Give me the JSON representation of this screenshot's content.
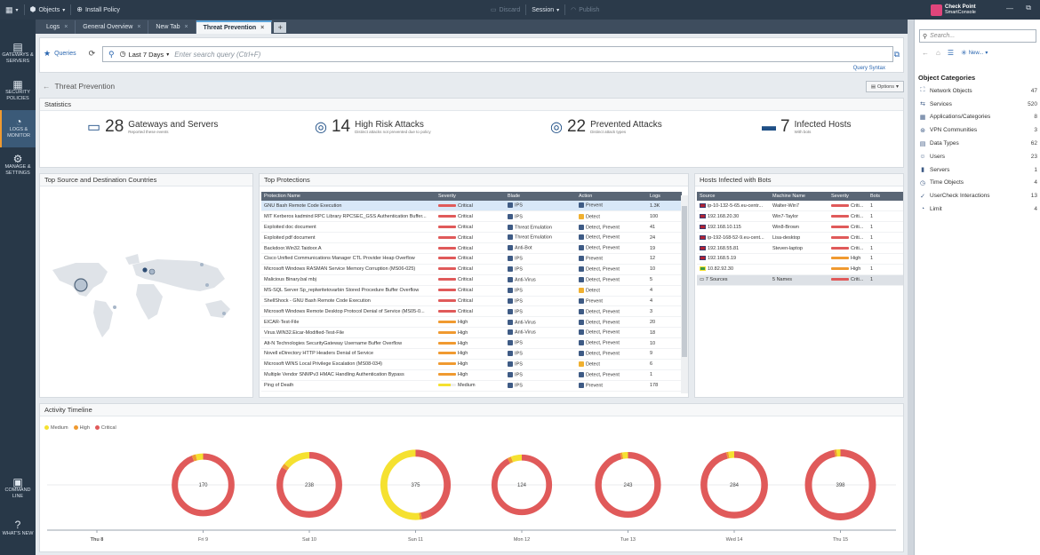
{
  "topbar": {
    "objects_label": "Objects",
    "install_policy_label": "Install Policy",
    "discard_label": "Discard",
    "session_label": "Session",
    "publish_label": "Publish"
  },
  "tabs": [
    {
      "label": "Logs"
    },
    {
      "label": "General Overview"
    },
    {
      "label": "New Tab"
    },
    {
      "label": "Threat Prevention"
    }
  ],
  "leftnav": [
    {
      "label": "GATEWAYS & SERVERS",
      "icon": "gateways-icon"
    },
    {
      "label": "SECURITY POLICIES",
      "icon": "policies-icon"
    },
    {
      "label": "LOGS & MONITOR",
      "icon": "gauge-icon",
      "active": true
    },
    {
      "label": "MANAGE & SETTINGS",
      "icon": "gear-icon"
    },
    {
      "label": "COMMAND LINE",
      "icon": "terminal-icon"
    },
    {
      "label": "WHAT'S NEW",
      "icon": "help-icon"
    }
  ],
  "query": {
    "queries_label": "Queries",
    "time_range": "Last 7 Days",
    "placeholder": "Enter search query (Ctrl+F)",
    "syntax_label": "Query Syntax"
  },
  "breadcrumb": "Threat Prevention",
  "options_label": "Options",
  "statistics": {
    "title": "Statistics",
    "items": [
      {
        "num": "28",
        "title": "Gateways and Servers",
        "sub": "Reported these events"
      },
      {
        "num": "14",
        "title": "High Risk Attacks",
        "sub": "Distinct attacks not prevented due to policy"
      },
      {
        "num": "22",
        "title": "Prevented Attacks",
        "sub": "Distinct attack types"
      },
      {
        "num": "7",
        "title": "Infected Hosts",
        "sub": "With bots"
      }
    ]
  },
  "countries_panel": {
    "title": "Top Source and Destination Countries"
  },
  "protections": {
    "title": "Top Protections",
    "columns": [
      "Protection Name",
      "Severity",
      "Blade",
      "Action",
      "Logs"
    ],
    "rows": [
      {
        "name": "GNU Bash Remote Code Execution",
        "severity": "Critical",
        "blade": "IPS",
        "action": "Prevent",
        "logs": "1.3K"
      },
      {
        "name": "MIT Kerberos kadmind RPC Library RPCSEC_GSS Authentication Buffer...",
        "severity": "Critical",
        "blade": "IPS",
        "action": "Detect",
        "logs": "100"
      },
      {
        "name": "Exploited doc document",
        "severity": "Critical",
        "blade": "Threat Emulation",
        "action": "Detect, Prevent",
        "logs": "41"
      },
      {
        "name": "Exploited pdf document",
        "severity": "Critical",
        "blade": "Threat Emulation",
        "action": "Detect, Prevent",
        "logs": "24"
      },
      {
        "name": "Backdoor.Win32.Taidoor.A",
        "severity": "Critical",
        "blade": "Anti-Bot",
        "action": "Detect, Prevent",
        "logs": "19"
      },
      {
        "name": "Cisco Unified Communications Manager CTL Provider Heap Overflow",
        "severity": "Critical",
        "blade": "IPS",
        "action": "Prevent",
        "logs": "12"
      },
      {
        "name": "Microsoft Windows RASMAN Service Memory Corruption (MS06-025)",
        "severity": "Critical",
        "blade": "IPS",
        "action": "Detect, Prevent",
        "logs": "10"
      },
      {
        "name": "Malicious Binary.bal mbj",
        "severity": "Critical",
        "blade": "Anti-Virus",
        "action": "Detect, Prevent",
        "logs": "5"
      },
      {
        "name": "MS-SQL Server Sp_replwritetovarbin Stored Procedure Buffer Overflow",
        "severity": "Critical",
        "blade": "IPS",
        "action": "Detect",
        "logs": "4"
      },
      {
        "name": "ShellShock - GNU Bash Remote Code Execution",
        "severity": "Critical",
        "blade": "IPS",
        "action": "Prevent",
        "logs": "4"
      },
      {
        "name": "Microsoft Windows Remote Desktop Protocol Denial of Service (MS05-0...",
        "severity": "Critical",
        "blade": "IPS",
        "action": "Detect, Prevent",
        "logs": "3"
      },
      {
        "name": "EICAR-Test-File",
        "severity": "High",
        "blade": "Anti-Virus",
        "action": "Detect, Prevent",
        "logs": "20"
      },
      {
        "name": "Virus.WIN32.Eicar-Modified-Test-File",
        "severity": "High",
        "blade": "Anti-Virus",
        "action": "Detect, Prevent",
        "logs": "18"
      },
      {
        "name": "Alt-N Technologies SecurityGateway Username Buffer Overflow",
        "severity": "High",
        "blade": "IPS",
        "action": "Detect, Prevent",
        "logs": "10"
      },
      {
        "name": "Novell eDirectory HTTP Headers Denial of Service",
        "severity": "High",
        "blade": "IPS",
        "action": "Detect, Prevent",
        "logs": "9"
      },
      {
        "name": "Microsoft WINS Local Privilege Escalation (MS08-034)",
        "severity": "High",
        "blade": "IPS",
        "action": "Detect",
        "logs": "6"
      },
      {
        "name": "Multiple Vendor SNMPv3 HMAC Handling Authentication Bypass",
        "severity": "High",
        "blade": "IPS",
        "action": "Detect, Prevent",
        "logs": "1"
      },
      {
        "name": "Ping of Death",
        "severity": "Medium",
        "blade": "IPS",
        "action": "Prevent",
        "logs": "178"
      }
    ]
  },
  "hosts": {
    "title": "Hosts Infected with Bots",
    "columns": [
      "Source",
      "Machine Name",
      "Severity",
      "Bots"
    ],
    "rows": [
      {
        "source": "ip-10-132-5-65.eu-centr...",
        "machine": "Walter-Win7",
        "severity": "Criti...",
        "level": "critical",
        "bots": "1"
      },
      {
        "source": "192.168.20.30",
        "machine": "Win7-Taylor",
        "severity": "Criti...",
        "level": "critical",
        "bots": "1"
      },
      {
        "source": "192.168.10.115",
        "machine": "Win8-Brown",
        "severity": "Criti...",
        "level": "critical",
        "bots": "1"
      },
      {
        "source": "ip-192-168-52-9.eu-cent...",
        "machine": "Lisa-desktop",
        "severity": "Criti...",
        "level": "critical",
        "bots": "1"
      },
      {
        "source": "192.168.55.81",
        "machine": "Steven-laptop",
        "severity": "Criti...",
        "level": "critical",
        "bots": "1"
      },
      {
        "source": "192.168.5.19",
        "machine": "",
        "severity": "High",
        "level": "high",
        "bots": "1"
      },
      {
        "source": "10.82.92.30",
        "machine": "",
        "severity": "High",
        "level": "high",
        "bots": "1"
      }
    ],
    "summary": {
      "source": "7 Sources",
      "machine": "5 Names",
      "severity": "Criti...",
      "bots": "1"
    }
  },
  "timeline": {
    "title": "Activity Timeline",
    "legend": [
      {
        "name": "Medium",
        "color": "#f5e130"
      },
      {
        "name": "High",
        "color": "#f09a30"
      },
      {
        "name": "Critical",
        "color": "#e05a5a"
      }
    ],
    "days": [
      {
        "label": "Thu 8",
        "total": null,
        "bold": true
      },
      {
        "label": "Fri 9",
        "total": "170",
        "medium": 0.04,
        "high": 0.02,
        "critical": 0.94
      },
      {
        "label": "Sat 10",
        "total": "238",
        "medium": 0.14,
        "high": 0.02,
        "critical": 0.84
      },
      {
        "label": "Sun 11",
        "total": "375",
        "medium": 0.52,
        "high": 0.01,
        "critical": 0.47
      },
      {
        "label": "Mon 12",
        "total": "124",
        "medium": 0.06,
        "high": 0.02,
        "critical": 0.92
      },
      {
        "label": "Tue 13",
        "total": "243",
        "medium": 0.03,
        "high": 0.01,
        "critical": 0.96
      },
      {
        "label": "Wed 14",
        "total": "284",
        "medium": 0.03,
        "high": 0.01,
        "critical": 0.96
      },
      {
        "label": "Thu 15",
        "total": "398",
        "medium": 0.02,
        "high": 0.01,
        "critical": 0.97
      }
    ]
  },
  "right_panel": {
    "brand_line1": "Check Point",
    "brand_line2": "SmartConsole",
    "search_placeholder": "Search...",
    "new_label": "New...",
    "categories_title": "Object Categories",
    "categories": [
      {
        "name": "Network Objects",
        "count": "47",
        "icon": "network-icon"
      },
      {
        "name": "Services",
        "count": "520",
        "icon": "services-icon"
      },
      {
        "name": "Applications/Categories",
        "count": "8",
        "icon": "apps-icon"
      },
      {
        "name": "VPN Communities",
        "count": "3",
        "icon": "vpn-icon"
      },
      {
        "name": "Data Types",
        "count": "62",
        "icon": "data-types-icon"
      },
      {
        "name": "Users",
        "count": "23",
        "icon": "users-icon"
      },
      {
        "name": "Servers",
        "count": "1",
        "icon": "servers-icon"
      },
      {
        "name": "Time Objects",
        "count": "4",
        "icon": "time-icon"
      },
      {
        "name": "UserCheck Interactions",
        "count": "13",
        "icon": "usercheck-icon"
      },
      {
        "name": "Limit",
        "count": "4",
        "icon": "limit-icon"
      }
    ]
  }
}
